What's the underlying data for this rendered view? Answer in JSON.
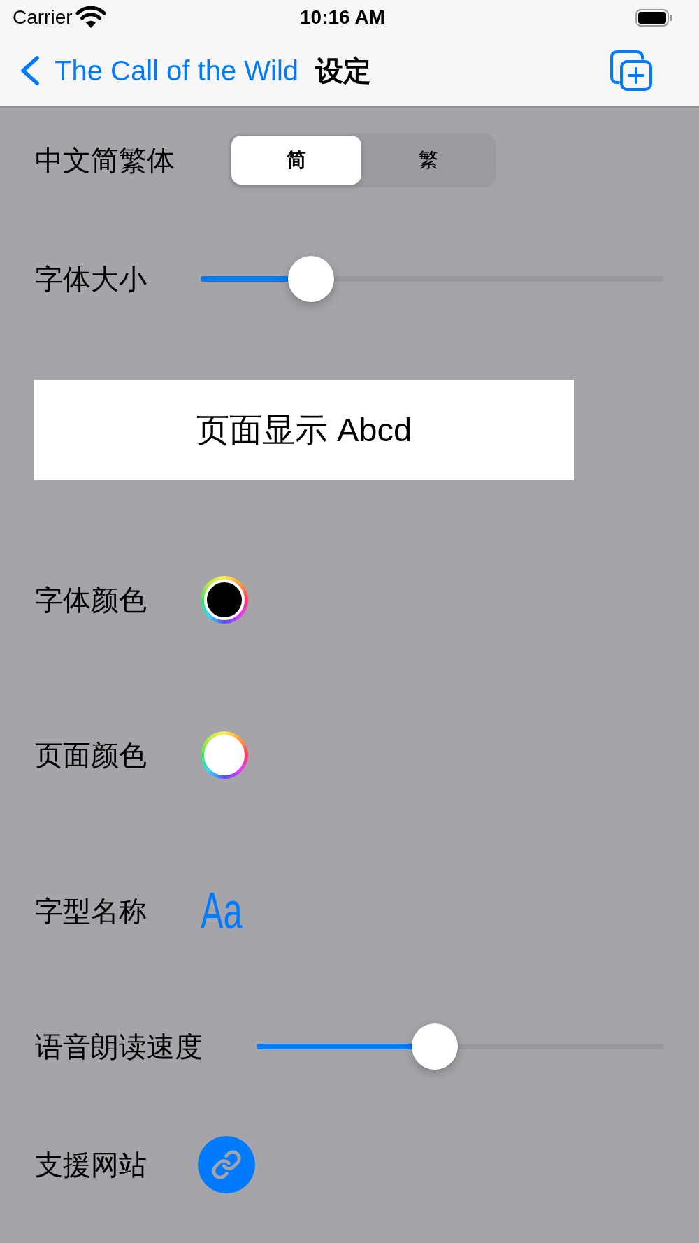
{
  "status_bar": {
    "carrier": "Carrier",
    "time": "10:16 AM"
  },
  "nav_bar": {
    "back_label": "The Call of the Wild",
    "title": "设定"
  },
  "settings": [
    {
      "kind": "segmented",
      "label": "中文简繁体",
      "segments": [
        {
          "label": "简",
          "selected": true
        },
        {
          "label": "繁",
          "selected": false
        }
      ]
    },
    {
      "kind": "slider",
      "label": "字体大小",
      "level": 0.21
    },
    {
      "kind": "preview",
      "text": "页面显示 Abcd"
    },
    {
      "kind": "color",
      "label": "字体颜色",
      "color": "#000000"
    },
    {
      "kind": "color",
      "label": "页面颜色",
      "color": "#ffffff"
    },
    {
      "kind": "font",
      "label": "字型名称",
      "sample": "Aa"
    },
    {
      "kind": "slider",
      "label": "语音朗读速度",
      "level": 0.43
    },
    {
      "kind": "link",
      "label": "支援网站"
    }
  ]
}
